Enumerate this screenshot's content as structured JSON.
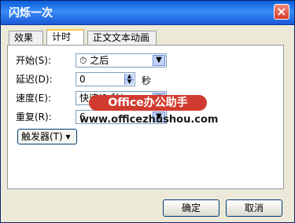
{
  "window": {
    "title": "闪烁一次"
  },
  "tabs": [
    {
      "label": "效果"
    },
    {
      "label": "计时"
    },
    {
      "label": "正文文本动画"
    }
  ],
  "timing": {
    "start": {
      "label": "开始(S):",
      "value": "之后"
    },
    "delay": {
      "label": "延迟(D):",
      "value": "0",
      "unit": "秒"
    },
    "speed": {
      "label": "速度(E):",
      "value": "快速(1 秒)"
    },
    "repeat": {
      "label": "重复(R):",
      "value": "6"
    },
    "trigger": {
      "label": "触发器(T)",
      "arrow": "▾"
    }
  },
  "watermark": {
    "brand": "Office办公助手",
    "url": "www.officezhushou.com"
  },
  "buttons": {
    "ok": "确定",
    "cancel": "取消"
  }
}
